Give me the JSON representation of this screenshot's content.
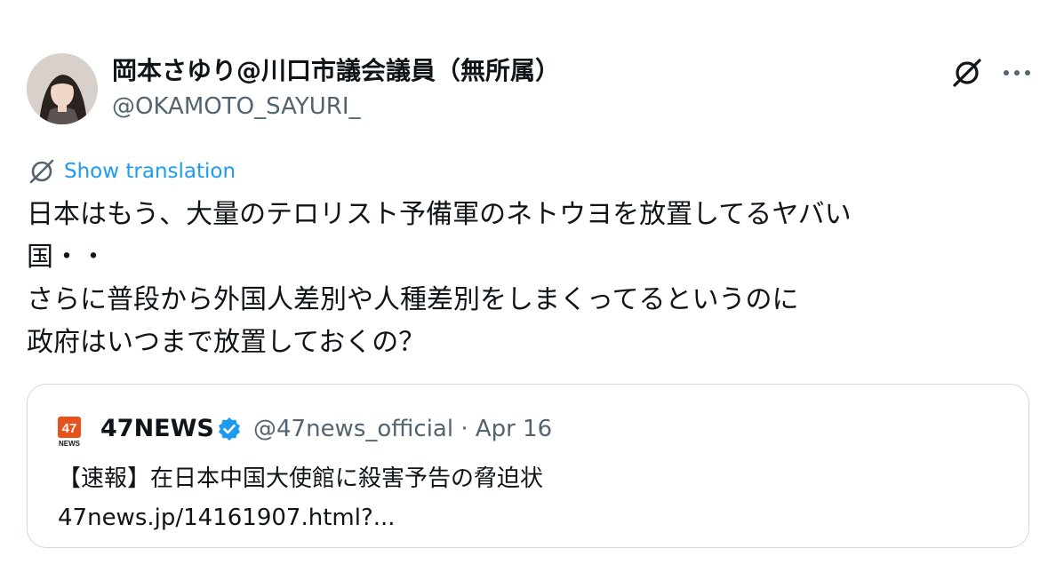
{
  "author": {
    "name": "岡本さゆり@川口市議会議員（無所属）",
    "handle": "@OKAMOTO_SAYURI_",
    "avatar_icon": "profile-photo"
  },
  "actions": {
    "grok_icon": "grok-icon",
    "more_icon": "more-dots-icon"
  },
  "translation": {
    "label": "Show translation",
    "icon": "translate-icon"
  },
  "tweet": {
    "lines": [
      "日本はもう、大量のテロリスト予備軍のネトウヨを放置してるヤバい",
      "国・・",
      "さらに普段から外国人差別や人種差別をしまくってるというのに",
      "政府はいつまで放置しておくの？"
    ]
  },
  "quote": {
    "logo_text": "47",
    "logo_sub": "NEWS",
    "name": "47NEWS",
    "verified_icon": "verified-badge-icon",
    "meta": "@47news_official · Apr 16",
    "body_lines": [
      "【速報】在日本中国大使館に殺害予告の脅迫状",
      "47news.jp/14161907.html?..."
    ]
  },
  "colors": {
    "link": "#1d9bf0",
    "secondary_text": "#536471",
    "border": "#cfd9de",
    "logo_orange": "#e8501c",
    "verified_blue": "#1d9bf0"
  }
}
